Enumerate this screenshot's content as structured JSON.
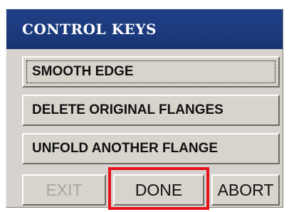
{
  "window": {
    "title": "CONTROL KEYS"
  },
  "keys": [
    {
      "label": "SMOOTH EDGE",
      "focused": true
    },
    {
      "label": "DELETE ORIGINAL FLANGES",
      "focused": false
    },
    {
      "label": "UNFOLD ANOTHER FLANGE",
      "focused": false
    }
  ],
  "actions": {
    "exit": {
      "label": "EXIT",
      "enabled": false
    },
    "done": {
      "label": "DONE",
      "enabled": true,
      "highlighted": true
    },
    "abort": {
      "label": "ABORT",
      "enabled": true
    }
  },
  "colors": {
    "titlebar": "#1b3a7e",
    "panel": "#d6d3ce",
    "highlight": "#e8111a",
    "disabled_text": "#a9a6a0"
  }
}
